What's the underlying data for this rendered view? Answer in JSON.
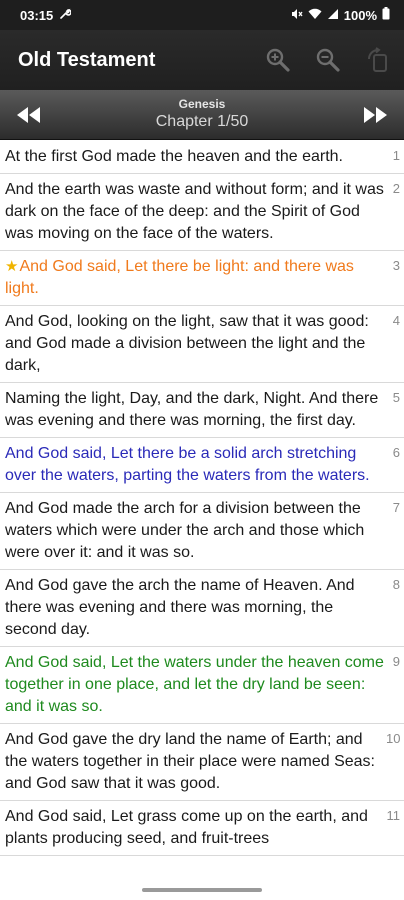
{
  "status_bar": {
    "time": "03:15",
    "battery": "100%",
    "colors": {
      "background": "#1e1e1e",
      "text": "#ffffff"
    },
    "icons": [
      "wrench-icon",
      "mute-icon",
      "wifi-icon",
      "signal-icon",
      "battery-icon"
    ]
  },
  "app_bar": {
    "title": "Old Testament",
    "actions": [
      "zoom-in-icon",
      "zoom-out-icon",
      "rotate-icon"
    ]
  },
  "navigation": {
    "book": "Genesis",
    "chapter_label": "Chapter",
    "chapter_position": "1/50",
    "prev_icon": "rewind-icon",
    "next_icon": "fast-forward-icon"
  },
  "highlight_colors": {
    "orange": "#f07a1c",
    "blue": "#2a2ab8",
    "green": "#1e8a1e",
    "star": "#f0b400"
  },
  "verses": [
    {
      "num": "1",
      "text": "At the first God made the heaven and the earth.",
      "highlight": "none",
      "starred": false
    },
    {
      "num": "2",
      "text": "And the earth was waste and without form; and it was dark on the face of the deep: and the Spirit of God was moving on the face of the waters.",
      "highlight": "none",
      "starred": false
    },
    {
      "num": "3",
      "text": "And God said, Let there be light: and there was light.",
      "highlight": "orange",
      "starred": true
    },
    {
      "num": "4",
      "text": "And God, looking on the light, saw that it was good: and God made a division between the light and the dark,",
      "highlight": "none",
      "starred": false
    },
    {
      "num": "5",
      "text": "Naming the light, Day, and the dark, Night. And there was evening and there was morning, the first day.",
      "highlight": "none",
      "starred": false
    },
    {
      "num": "6",
      "text": "And God said, Let there be a solid arch stretching over the waters, parting the waters from the waters.",
      "highlight": "blue",
      "starred": false
    },
    {
      "num": "7",
      "text": "And God made the arch for a division between the waters which were under the arch and those which were over it: and it was so.",
      "highlight": "none",
      "starred": false
    },
    {
      "num": "8",
      "text": "And God gave the arch the name of Heaven. And there was evening and there was morning, the second day.",
      "highlight": "none",
      "starred": false
    },
    {
      "num": "9",
      "text": "And God said, Let the waters under the heaven come together in one place, and let the dry land be seen: and it was so.",
      "highlight": "green",
      "starred": false
    },
    {
      "num": "10",
      "text": "And God gave the dry land the name of Earth; and the waters together in their place were named Seas: and God saw that it was good.",
      "highlight": "none",
      "starred": false
    },
    {
      "num": "11",
      "text": "And God said, Let grass come up on the earth, and plants producing seed, and fruit-trees",
      "highlight": "none",
      "starred": false
    }
  ]
}
